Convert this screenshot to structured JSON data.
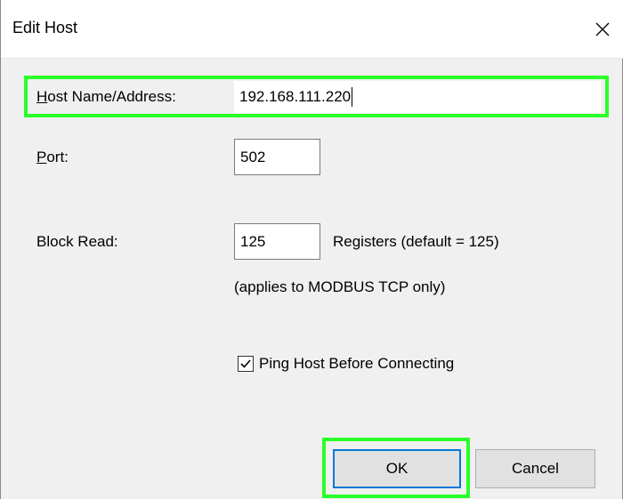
{
  "dialog": {
    "title": "Edit Host",
    "close_glyph": "✕"
  },
  "fields": {
    "host": {
      "label_underlined": "H",
      "label_rest": "ost Name/Address:",
      "value": "192.168.111.220"
    },
    "port": {
      "label_underlined": "P",
      "label_rest": "ort:",
      "value": "502"
    },
    "block_read": {
      "label": "Block Read:",
      "value": "125",
      "suffix": "Registers (default = 125)",
      "note": "(applies to MODBUS TCP only)"
    }
  },
  "ping": {
    "checked": true,
    "label": "Ping Host Before Connecting"
  },
  "buttons": {
    "ok": "OK",
    "cancel": "Cancel"
  },
  "colors": {
    "highlight": "#2aff2a",
    "default_button_border": "#0078d7",
    "dialog_bg": "#f0f0f0"
  }
}
